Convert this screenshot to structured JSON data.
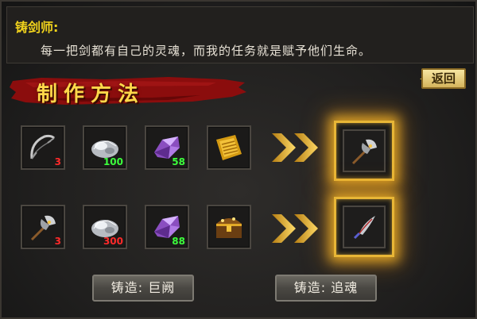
{
  "npc": {
    "name": "铸剑师:",
    "speech": "每一把剑都有自己的灵魂，而我的任务就是赋予他们生命。"
  },
  "panel": {
    "title": "制作方法",
    "back_label": "返回"
  },
  "recipes": [
    {
      "materials": [
        {
          "icon": "bow-icon",
          "count": "3",
          "count_color": "red"
        },
        {
          "icon": "silver-ore-icon",
          "count": "100",
          "count_color": "green"
        },
        {
          "icon": "purple-crystal-icon",
          "count": "58",
          "count_color": "green"
        },
        {
          "icon": "gold-scroll-icon",
          "count": ""
        }
      ],
      "result_icon": "battle-axe-icon",
      "forge_label": "铸造: 巨阙"
    },
    {
      "materials": [
        {
          "icon": "battle-axe-icon",
          "count": "3",
          "count_color": "red"
        },
        {
          "icon": "silver-ore-icon",
          "count": "300",
          "count_color": "red"
        },
        {
          "icon": "purple-crystal-icon",
          "count": "88",
          "count_color": "green"
        },
        {
          "icon": "treasure-chest-icon",
          "count": ""
        }
      ],
      "result_icon": "curved-blade-icon",
      "forge_label": "铸造: 追魂"
    }
  ]
}
